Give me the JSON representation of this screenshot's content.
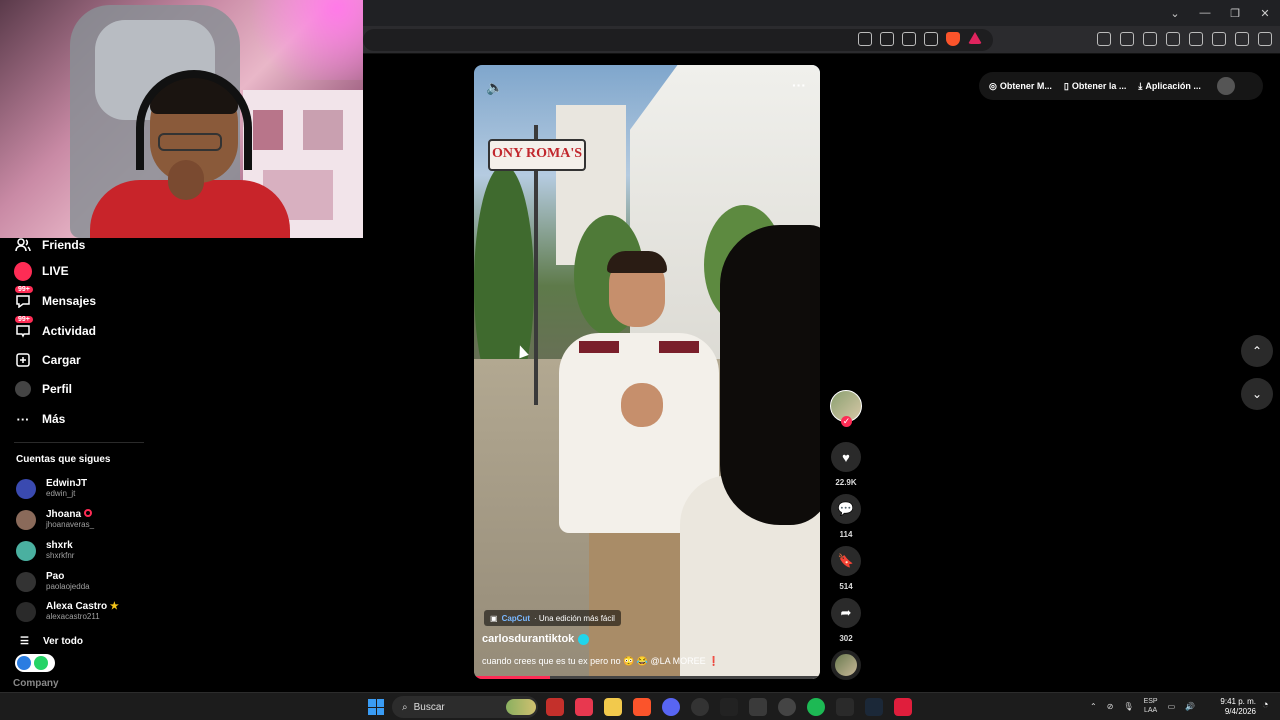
{
  "sidebar": {
    "items": [
      {
        "label": "Friends",
        "icon": "friends-icon"
      },
      {
        "label": "LIVE",
        "icon": "live-icon"
      },
      {
        "label": "Mensajes",
        "icon": "messages-icon",
        "badge": "99+"
      },
      {
        "label": "Actividad",
        "icon": "activity-icon",
        "badge": "99+"
      },
      {
        "label": "Cargar",
        "icon": "upload-icon"
      },
      {
        "label": "Perfil",
        "icon": "profile-icon"
      },
      {
        "label": "Más",
        "icon": "more-icon"
      }
    ],
    "following_title": "Cuentas que sigues",
    "following": [
      {
        "name": "EdwinJT",
        "username": "edwin_jt",
        "color": "#3a4ab0"
      },
      {
        "name": "Jhoana",
        "username": "jhoanaveras_",
        "color": "#8a6a5a"
      },
      {
        "name": "shxrk",
        "username": "shxrkfnr",
        "color": "#4ab0a0"
      },
      {
        "name": "Pao",
        "username": "paolaojedda",
        "color": "#333333"
      },
      {
        "name": "Alexa Castro",
        "username": "alexacastro211",
        "color": "#2a2a2a"
      }
    ],
    "see_all": "Ver todo",
    "company": "Company"
  },
  "video": {
    "sign_text": "ONY ROMA'S",
    "capcut_brand": "CapCut",
    "capcut_text": "· Una edición más fácil",
    "author": "carlosdurantiktok",
    "caption": "cuando crees que es tu ex pero no 😳 😂 @LA MOREE ❗",
    "progress": 0.22
  },
  "actions": {
    "likes": "22.9K",
    "comments": "114",
    "saves": "514",
    "shares": "302"
  },
  "top_pills": [
    {
      "label": "Obtener M...",
      "icon": "coin-icon"
    },
    {
      "label": "Obtener la ...",
      "icon": "phone-icon"
    },
    {
      "label": "Aplicación ...",
      "icon": "download-icon"
    }
  ],
  "taskbar": {
    "search_placeholder": "Buscar",
    "lang_line1": "ESP",
    "lang_line2": "LAA",
    "time": "9:41 p. m.",
    "date": "9/4/2026"
  },
  "colors": {
    "accent": "#fe2c55",
    "verified": "#20d5ec"
  }
}
